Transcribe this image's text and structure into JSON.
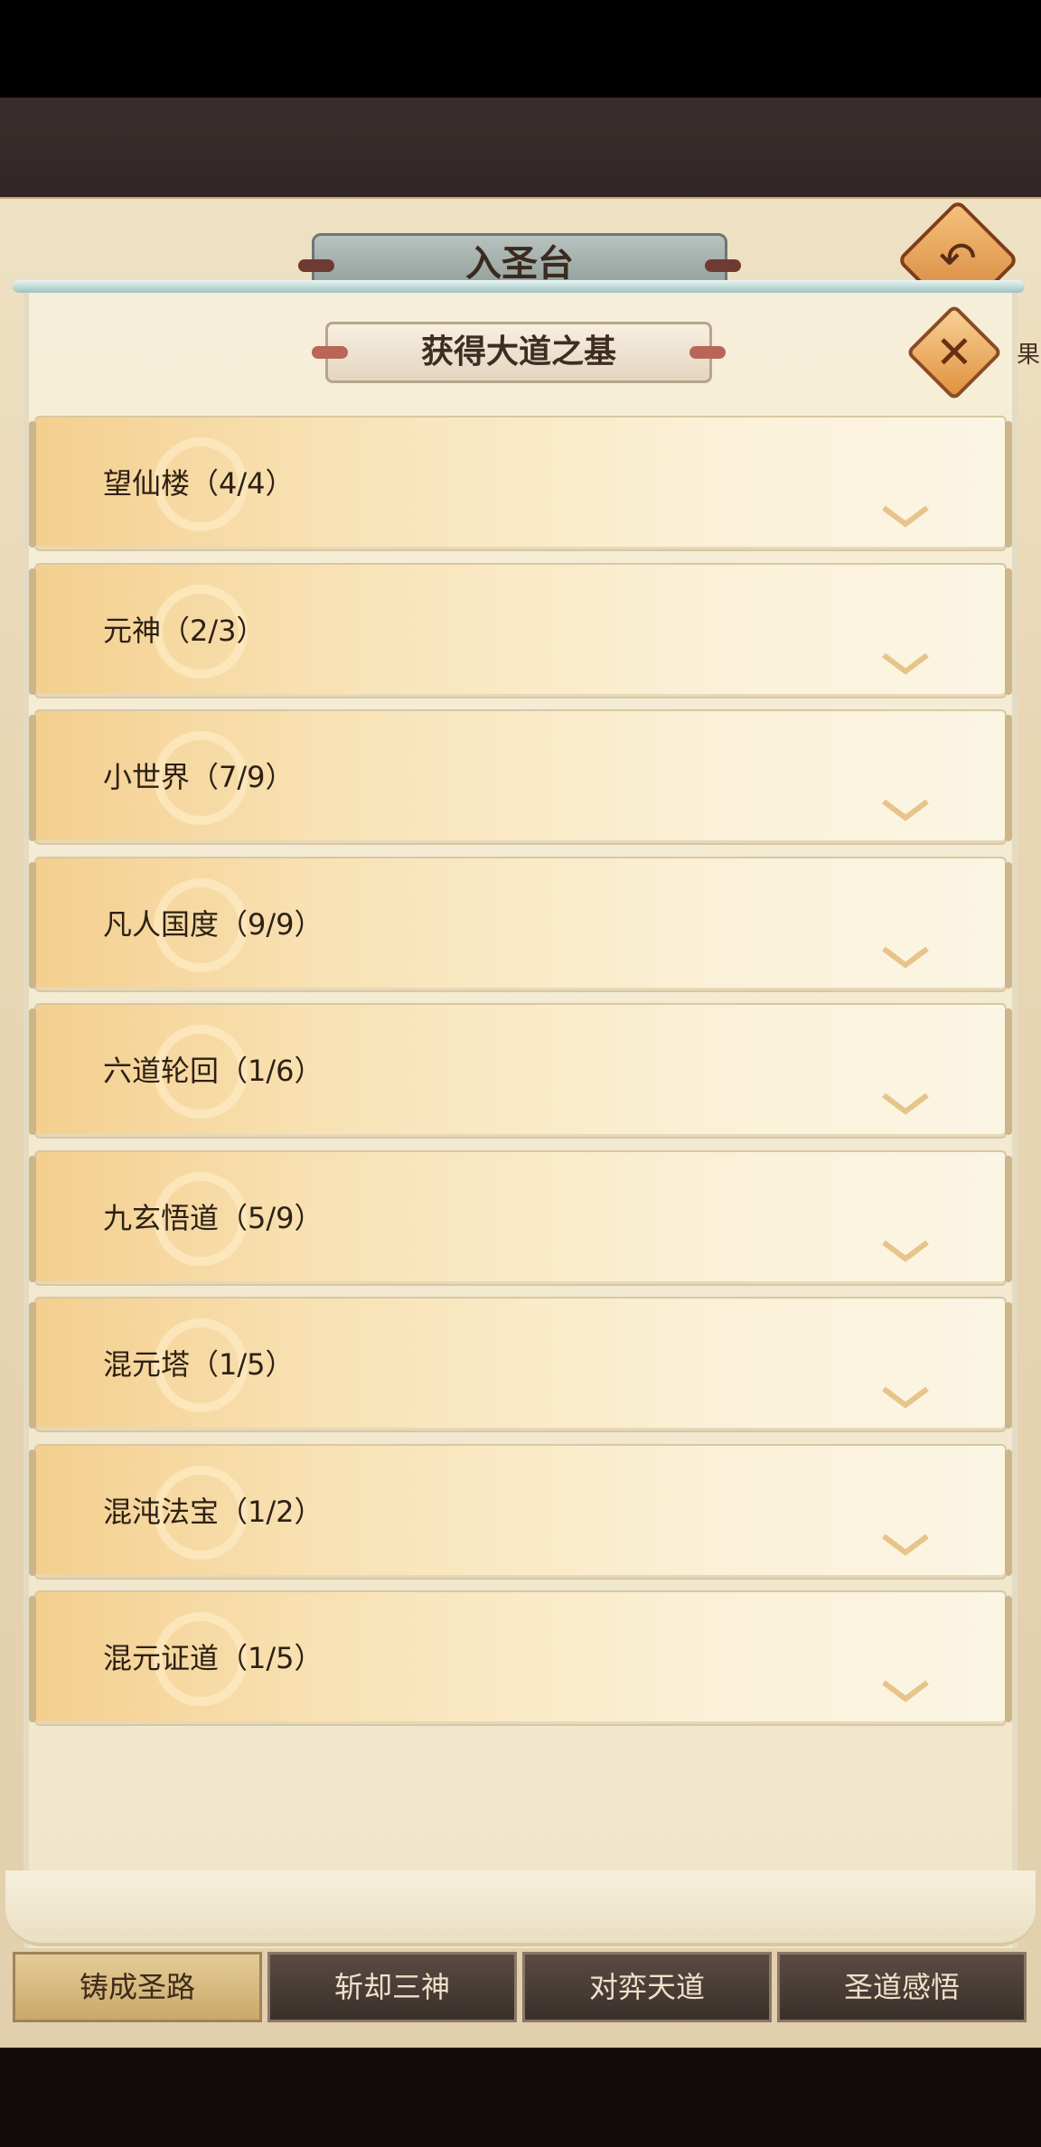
{
  "background_window": {
    "title": "入圣台"
  },
  "side_glyph": "果",
  "panel": {
    "title": "获得大道之基",
    "close_icon": "close-icon"
  },
  "items": [
    {
      "label": "望仙楼（4/4）"
    },
    {
      "label": "元神（2/3）"
    },
    {
      "label": "小世界（7/9）"
    },
    {
      "label": "凡人国度（9/9）"
    },
    {
      "label": "六道轮回（1/6）"
    },
    {
      "label": "九玄悟道（5/9）"
    },
    {
      "label": "混元塔（1/5）"
    },
    {
      "label": "混沌法宝（1/2）"
    },
    {
      "label": "混元证道（1/5）"
    }
  ],
  "tabs": [
    {
      "label": "铸成圣路",
      "active": true
    },
    {
      "label": "斩却三神",
      "active": false
    },
    {
      "label": "对弈天道",
      "active": false
    },
    {
      "label": "圣道感悟",
      "active": false
    }
  ],
  "colors": {
    "accent_orange": "#e0913e",
    "panel_bg": "#f6eed8",
    "tab_active": "#e4cc97",
    "tab_inactive": "#4a3d36"
  }
}
